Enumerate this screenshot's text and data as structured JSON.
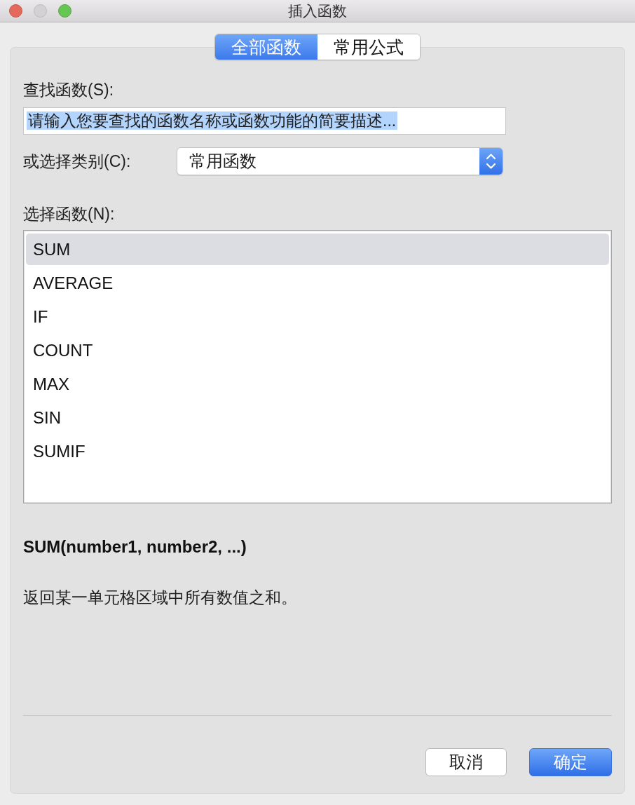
{
  "window": {
    "title": "插入函数"
  },
  "tabs": [
    {
      "label": "全部函数",
      "selected": true
    },
    {
      "label": "常用公式",
      "selected": false
    }
  ],
  "search": {
    "label": "查找函数(S):",
    "value": "请输入您要查找的函数名称或函数功能的简要描述...",
    "value_selected": true
  },
  "category": {
    "label": "或选择类别(C):",
    "value": "常用函数"
  },
  "function_list": {
    "label": "选择函数(N):",
    "items": [
      {
        "name": "SUM",
        "selected": true
      },
      {
        "name": "AVERAGE",
        "selected": false
      },
      {
        "name": "IF",
        "selected": false
      },
      {
        "name": "COUNT",
        "selected": false
      },
      {
        "name": "MAX",
        "selected": false
      },
      {
        "name": "SIN",
        "selected": false
      },
      {
        "name": "SUMIF",
        "selected": false
      }
    ]
  },
  "signature": "SUM(number1, number2, ...)",
  "description": "返回某一单元格区域中所有数值之和。",
  "buttons": [
    {
      "label": "取消",
      "kind": "default"
    },
    {
      "label": "确定",
      "kind": "primary"
    }
  ]
}
